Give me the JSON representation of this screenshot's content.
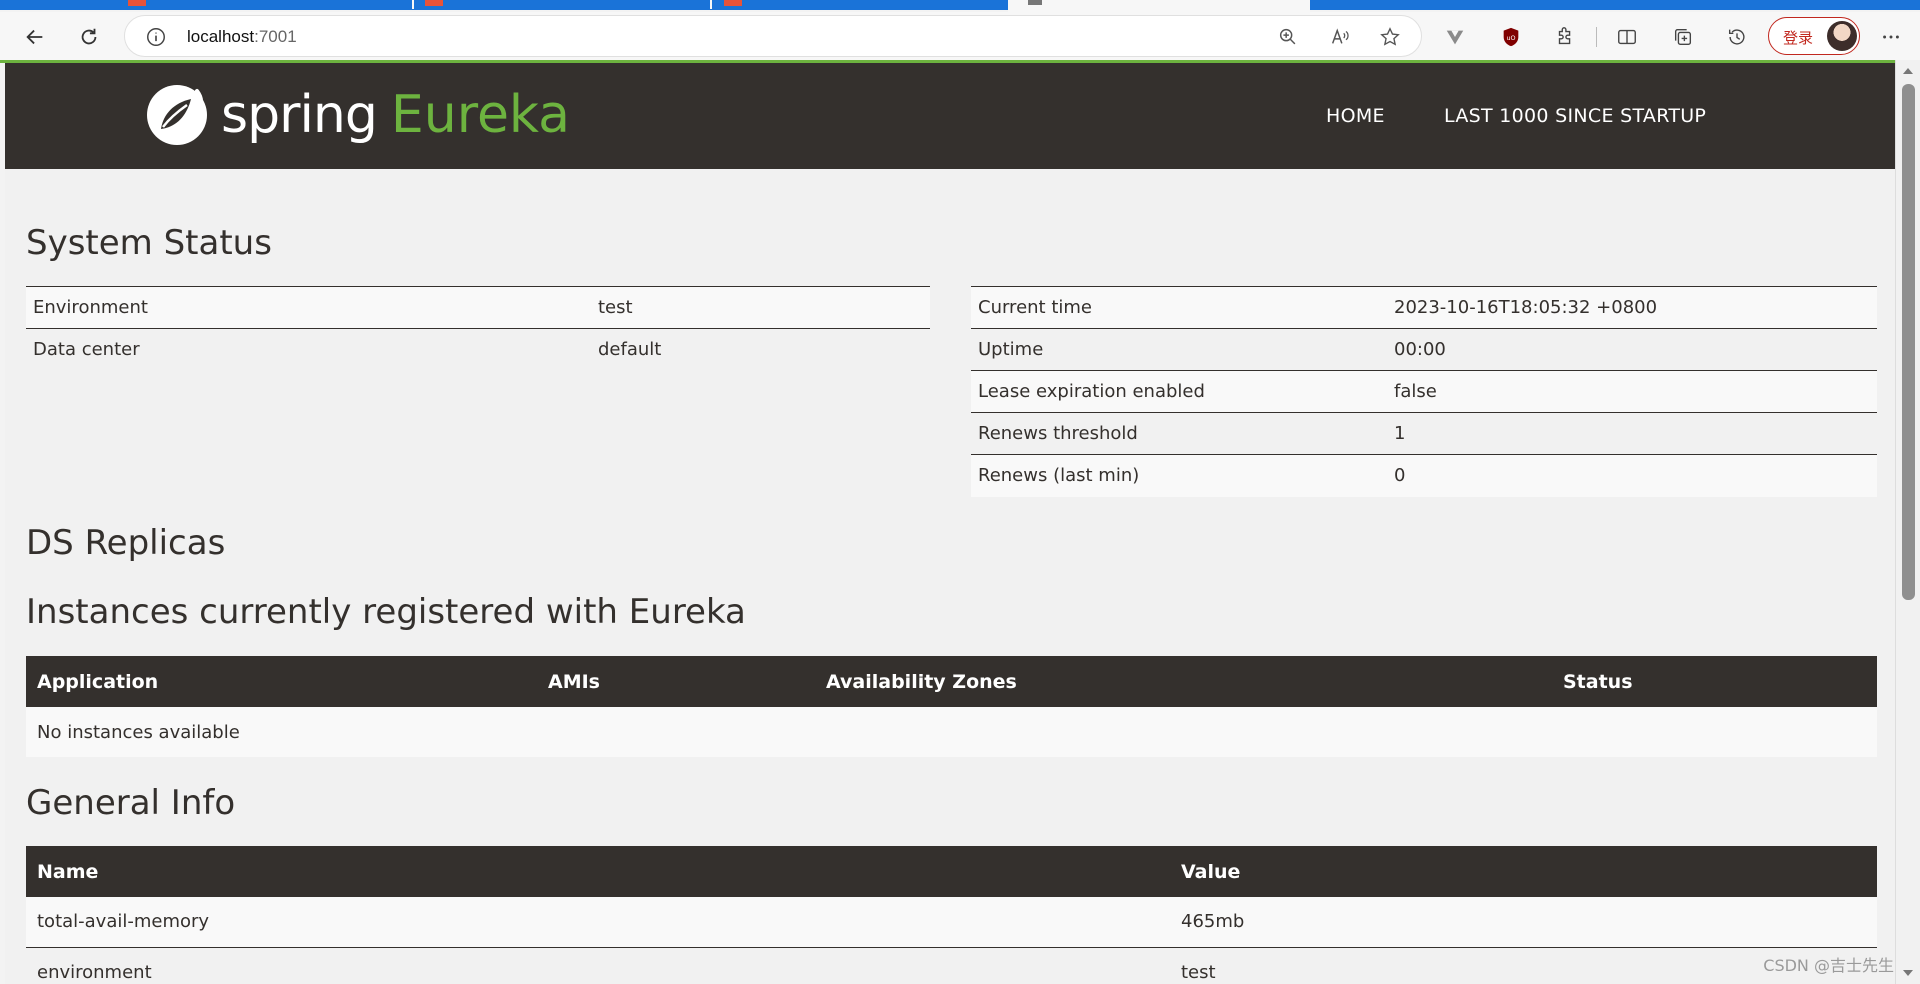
{
  "browser": {
    "url_host": "localhost",
    "url_port": ":7001",
    "login_label": "登录"
  },
  "nav": {
    "brand_spring": "spring",
    "brand_eureka": "Eureka",
    "home": "HOME",
    "last_1000": "LAST 1000 SINCE STARTUP"
  },
  "system_status": {
    "title": "System Status",
    "left": [
      {
        "label": "Environment",
        "value": "test"
      },
      {
        "label": "Data center",
        "value": "default"
      }
    ],
    "right": [
      {
        "label": "Current time",
        "value": "2023-10-16T18:05:32 +0800"
      },
      {
        "label": "Uptime",
        "value": "00:00"
      },
      {
        "label": "Lease expiration enabled",
        "value": "false"
      },
      {
        "label": "Renews threshold",
        "value": "1"
      },
      {
        "label": "Renews (last min)",
        "value": "0"
      }
    ]
  },
  "ds_replicas": {
    "title": "DS Replicas"
  },
  "instances": {
    "title": "Instances currently registered with Eureka",
    "columns": [
      "Application",
      "AMIs",
      "Availability Zones",
      "Status"
    ],
    "empty": "No instances available"
  },
  "general_info": {
    "title": "General Info",
    "columns": [
      "Name",
      "Value"
    ],
    "rows": [
      {
        "name": "total-avail-memory",
        "value": "465mb"
      },
      {
        "name": "environment",
        "value": "test"
      }
    ]
  },
  "watermark": "CSDN @吉士先生"
}
